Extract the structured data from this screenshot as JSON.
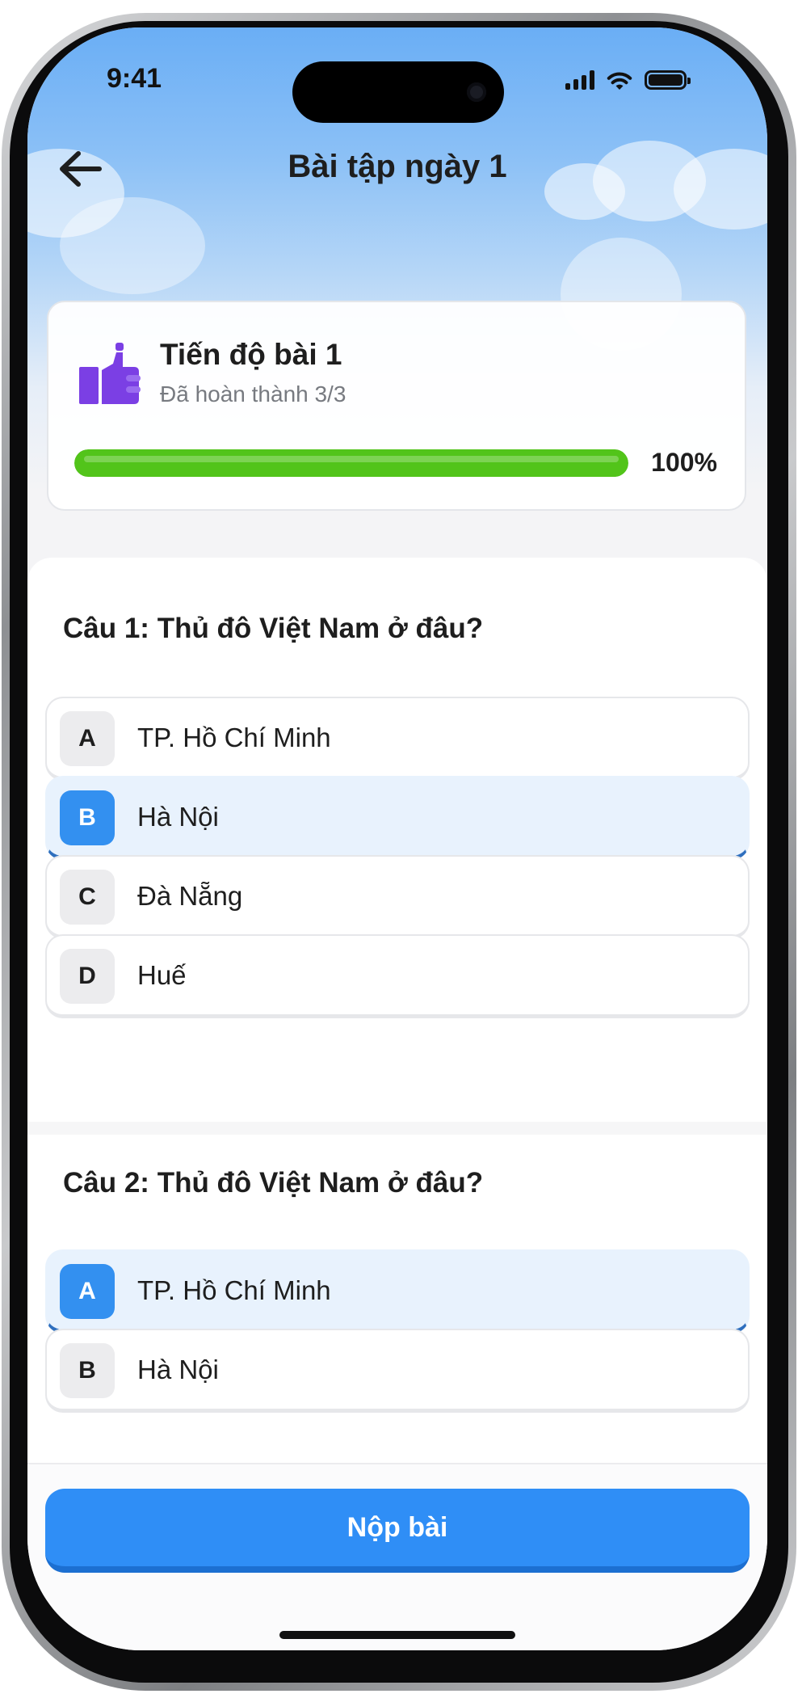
{
  "status_bar": {
    "time": "9:41"
  },
  "header": {
    "title": "Bài tập ngày 1",
    "back_icon": "arrow-left-icon"
  },
  "progress": {
    "title": "Tiến độ bài 1",
    "subtitle": "Đã hoàn thành 3/3",
    "percent_label": "100%",
    "percent_value": 100,
    "icon": "thumbs-up-icon",
    "bar_color": "#52c41a",
    "icon_color": "#7b3fe4"
  },
  "questions": [
    {
      "title": "Câu 1: Thủ đô Việt Nam ở đâu?",
      "options": [
        {
          "letter": "A",
          "text": "TP. Hồ Chí Minh",
          "selected": false
        },
        {
          "letter": "B",
          "text": "Hà Nội",
          "selected": true
        },
        {
          "letter": "C",
          "text": "Đà Nẵng",
          "selected": false
        },
        {
          "letter": "D",
          "text": "Huế",
          "selected": false
        }
      ]
    },
    {
      "title": "Câu 2: Thủ đô Việt Nam ở đâu?",
      "options": [
        {
          "letter": "A",
          "text": "TP. Hồ Chí Minh",
          "selected": true
        },
        {
          "letter": "B",
          "text": "Hà Nội",
          "selected": false
        }
      ]
    }
  ],
  "submit": {
    "label": "Nộp bài"
  },
  "colors": {
    "accent": "#2f8ef6",
    "selected_bg": "#e8f2fd"
  }
}
